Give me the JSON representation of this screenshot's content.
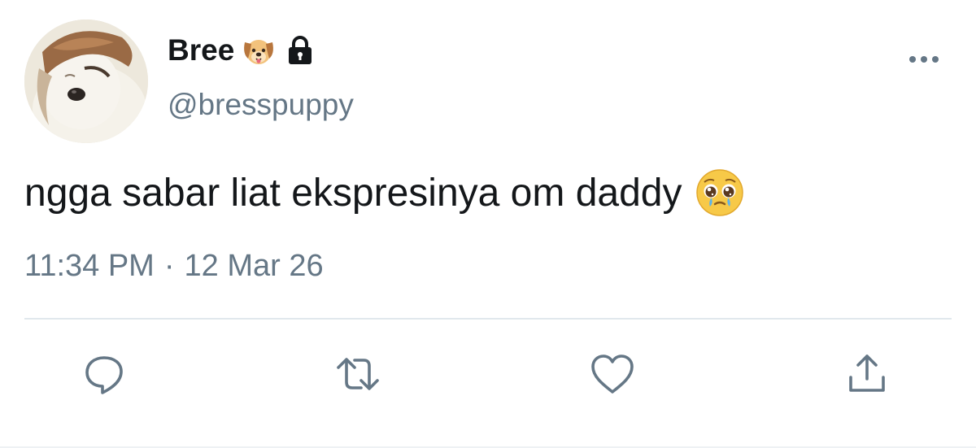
{
  "tweet": {
    "display_name": "Bree",
    "name_emoji": "dog-face-emoji",
    "badge": "lock-icon",
    "handle": "@bresspuppy",
    "text": "ngga sabar liat ekspresinya om daddy",
    "text_emoji": "pleading-face-emoji",
    "time": "11:34 PM",
    "separator": "·",
    "date": "12 Mar 26"
  },
  "actions": [
    {
      "icon": "reply-icon"
    },
    {
      "icon": "retweet-icon"
    },
    {
      "icon": "like-icon"
    },
    {
      "icon": "share-icon"
    }
  ],
  "colors": {
    "primary_text": "#14171a",
    "secondary_text": "#657786",
    "divider": "#e1e8ed",
    "icon": "#657786"
  }
}
